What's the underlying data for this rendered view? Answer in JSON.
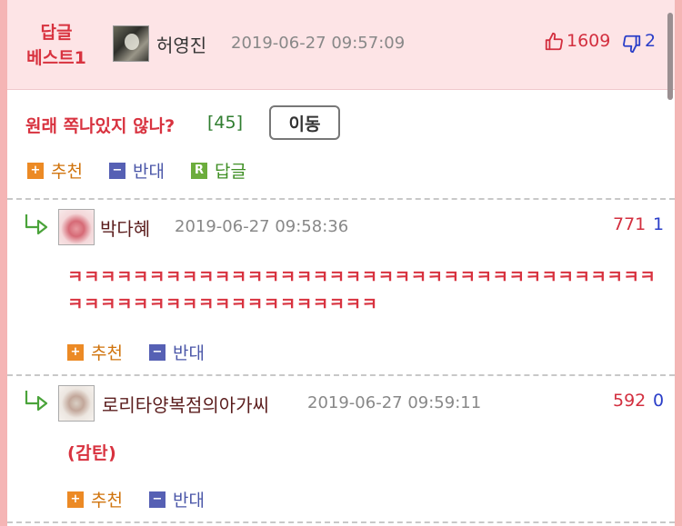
{
  "best": {
    "label_line1": "답글",
    "label_line2": "베스트1",
    "author": "허영진",
    "date": "2019-06-27 09:57:09",
    "likes": "1609",
    "dislikes": "2",
    "title": "원래 쪽나있지 않나?",
    "reply_count": "[45]",
    "move_label": "이동",
    "actions": {
      "recommend": "추천",
      "oppose": "반대",
      "reply": "답글"
    }
  },
  "comments": [
    {
      "author": "박다혜",
      "date": "2019-06-27 09:58:36",
      "likes": "771",
      "dislikes": "1",
      "body": "ㅋㅋㅋㅋㅋㅋㅋㅋㅋㅋㅋㅋㅋㅋㅋㅋㅋㅋㅋㅋㅋㅋㅋㅋㅋㅋㅋㅋㅋㅋㅋㅋㅋㅋㅋㅋㅋㅋㅋㅋㅋㅋㅋㅋㅋㅋㅋㅋㅋㅋㅋㅋㅋㅋㅋ",
      "actions": {
        "recommend": "추천",
        "oppose": "반대"
      }
    },
    {
      "author": "로리타양복점의아가씨",
      "date": "2019-06-27 09:59:11",
      "likes": "592",
      "dislikes": "0",
      "body": "(감탄)",
      "actions": {
        "recommend": "추천",
        "oppose": "반대"
      }
    }
  ],
  "icons": {
    "like": "thumbs-up-icon",
    "dislike": "thumbs-down-icon",
    "reply_arrow": "reply-arrow-icon",
    "plus": "plus-square-icon",
    "minus": "minus-square-icon",
    "reply": "r-square-icon"
  },
  "colors": {
    "outer_frame": "#f5b5b5",
    "best_bg": "#fde4e6",
    "accent_red": "#d8323f",
    "accent_blue": "#2a3ec8",
    "count_green": "#2f7d2f"
  }
}
